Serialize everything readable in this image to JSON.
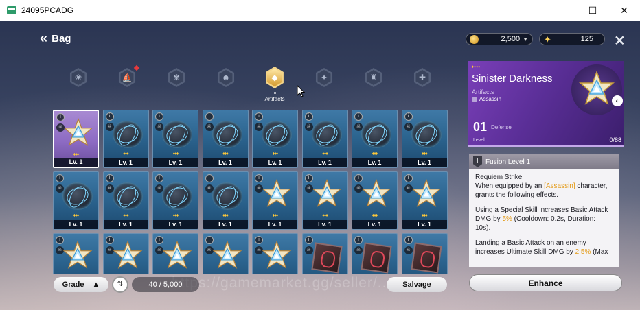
{
  "window": {
    "title": "24095PCADG",
    "controls": [
      "—",
      "☐",
      "✕"
    ]
  },
  "header": {
    "back_icon": "«",
    "title": "Bag"
  },
  "currency": [
    {
      "name": "gold-coin",
      "amount": "2,500",
      "arrow": "▼"
    },
    {
      "name": "star-crystal",
      "amount": "125"
    }
  ],
  "tabs": [
    {
      "id": "tab-0",
      "icon": "❀"
    },
    {
      "id": "tab-1",
      "icon": "⛵",
      "has_new": true
    },
    {
      "id": "tab-2",
      "icon": "✾"
    },
    {
      "id": "tab-3",
      "icon": "☻"
    },
    {
      "id": "tab-artifacts",
      "icon": "◆",
      "label": "Artifacts",
      "active": true
    },
    {
      "id": "tab-5",
      "icon": "✦"
    },
    {
      "id": "tab-6",
      "icon": "♜"
    },
    {
      "id": "tab-7",
      "icon": "✚"
    }
  ],
  "items": [
    {
      "kind": "star-artifact",
      "selected": true,
      "stars": "♦♦♦",
      "level": "Lv. 1"
    },
    {
      "kind": "rock",
      "stars": "♦♦♦",
      "level": "Lv. 1"
    },
    {
      "kind": "rock",
      "stars": "♦♦♦",
      "level": "Lv. 1"
    },
    {
      "kind": "rock",
      "stars": "♦♦♦",
      "level": "Lv. 1"
    },
    {
      "kind": "rock",
      "stars": "♦♦♦",
      "level": "Lv. 1"
    },
    {
      "kind": "rock",
      "stars": "♦♦♦",
      "level": "Lv. 1"
    },
    {
      "kind": "rock",
      "stars": "♦♦♦",
      "level": "Lv. 1"
    },
    {
      "kind": "rock",
      "stars": "♦♦♦",
      "level": "Lv. 1"
    },
    {
      "kind": "rock",
      "stars": "♦♦♦",
      "level": "Lv. 1"
    },
    {
      "kind": "rock",
      "stars": "♦♦♦",
      "level": "Lv. 1"
    },
    {
      "kind": "rock",
      "stars": "♦♦♦",
      "level": "Lv. 1"
    },
    {
      "kind": "rock",
      "stars": "♦♦♦",
      "level": "Lv. 1"
    },
    {
      "kind": "star-artifact",
      "stars": "♦♦♦",
      "level": "Lv. 1"
    },
    {
      "kind": "star-artifact",
      "stars": "♦♦♦",
      "level": "Lv. 1"
    },
    {
      "kind": "star-artifact",
      "stars": "♦♦♦",
      "level": "Lv. 1"
    },
    {
      "kind": "star-artifact",
      "stars": "♦♦♦",
      "level": "Lv. 1"
    },
    {
      "kind": "star-artifact",
      "stars": "",
      "level": ""
    },
    {
      "kind": "star-artifact",
      "stars": "",
      "level": ""
    },
    {
      "kind": "star-artifact",
      "stars": "",
      "level": ""
    },
    {
      "kind": "star-artifact",
      "stars": "",
      "level": ""
    },
    {
      "kind": "star-artifact",
      "stars": "",
      "level": ""
    },
    {
      "kind": "cube",
      "stars": "",
      "level": ""
    },
    {
      "kind": "cube",
      "stars": "",
      "level": ""
    },
    {
      "kind": "cube",
      "stars": "",
      "level": ""
    }
  ],
  "bottom": {
    "grade_label": "Grade",
    "grade_arrow": "▲",
    "sort_icon": "⇅",
    "capacity": "40 / 5,000",
    "salvage_label": "Salvage",
    "watermark": "https://gamemarket.gg/seller/..."
  },
  "detail": {
    "pips": "♦♦♦♦",
    "name": "Sinister Darkness",
    "type": "Artifacts",
    "class": "Assassin",
    "equip_icon": "◐",
    "stat_value": "01",
    "stat_label": "Defense",
    "level_label": "Level",
    "level_value": "0/88",
    "fusion_icon": "I",
    "fusion_title": "Fusion Level 1",
    "skill_name": "Requiem Strike  I",
    "line1_a": "When equipped by an ",
    "line1_hl": "[Assassin]",
    "line1_b": " character, grants the following effects.",
    "line2_a": "Using a Special Skill increases Basic Attack DMG by ",
    "line2_hl": "5%",
    "line2_b": " (Cooldown: 0.2s, Duration: 10s).",
    "line3_a": "Landing a Basic Attack on an enemy increases Ultimate Skill DMG by ",
    "line3_hl": "2.5%",
    "line3_b": " (Max"
  },
  "enhance_label": "Enhance"
}
